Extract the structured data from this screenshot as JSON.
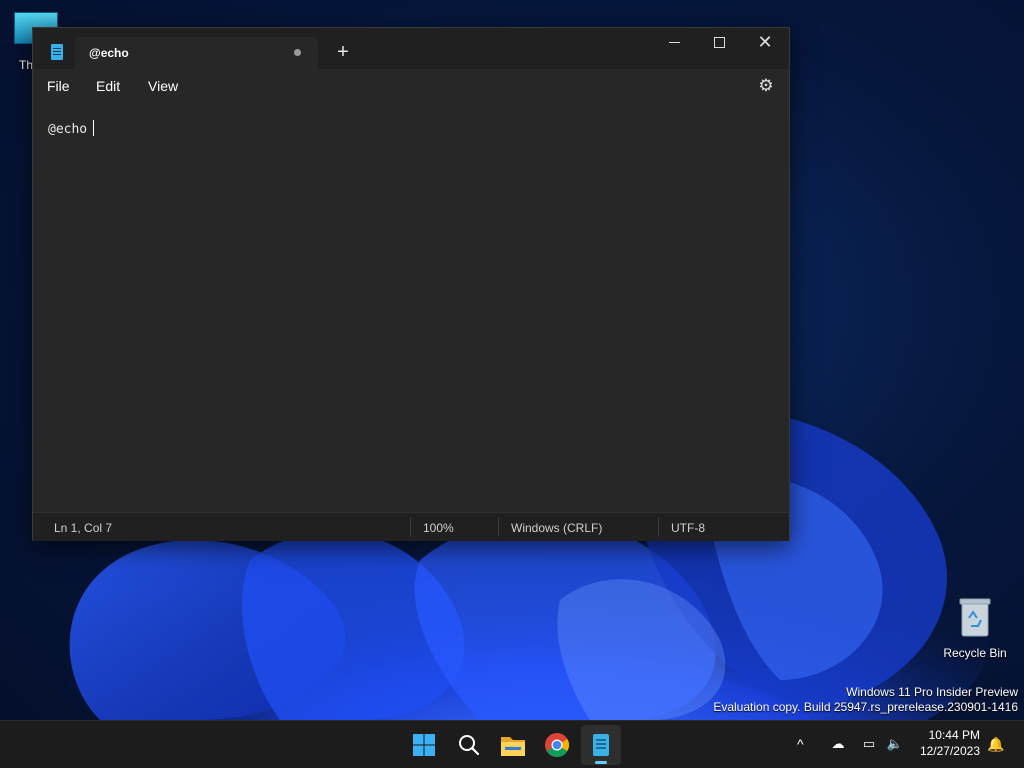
{
  "desktop": {
    "icons": [
      {
        "label": "Th",
        "icon": "this-pc-icon"
      },
      {
        "label": "Recycle Bin",
        "icon": "recycle-bin-icon"
      }
    ],
    "watermark": {
      "line1": "Windows 11 Pro Insider Preview",
      "line2": "Evaluation copy. Build 25947.rs_prerelease.230901-1416"
    }
  },
  "notepad": {
    "tab_title": "@echo",
    "tab_unsaved_indicator": "•",
    "new_tab_symbol": "+",
    "close_symbol": "✕",
    "settings_symbol": "⚙",
    "menu": [
      "File",
      "Edit",
      "View"
    ],
    "content": "@echo",
    "status": {
      "position": "Ln 1, Col 7",
      "zoom": "100%",
      "line_ending": "Windows (CRLF)",
      "encoding": "UTF-8"
    },
    "colors": {
      "background": "#272727",
      "titlebar": "#202020",
      "accent": "#60cdff"
    }
  },
  "taskbar": {
    "apps": [
      {
        "name": "Start",
        "icon": "windows-logo-icon"
      },
      {
        "name": "Search",
        "icon": "search-icon"
      },
      {
        "name": "File Explorer",
        "icon": "folder-icon"
      },
      {
        "name": "Google Chrome",
        "icon": "chrome-icon"
      },
      {
        "name": "Notepad",
        "icon": "notepad-icon",
        "active": true
      }
    ],
    "tray": {
      "chevron": "^",
      "time": "10:44 PM",
      "date": "12/27/2023"
    }
  }
}
